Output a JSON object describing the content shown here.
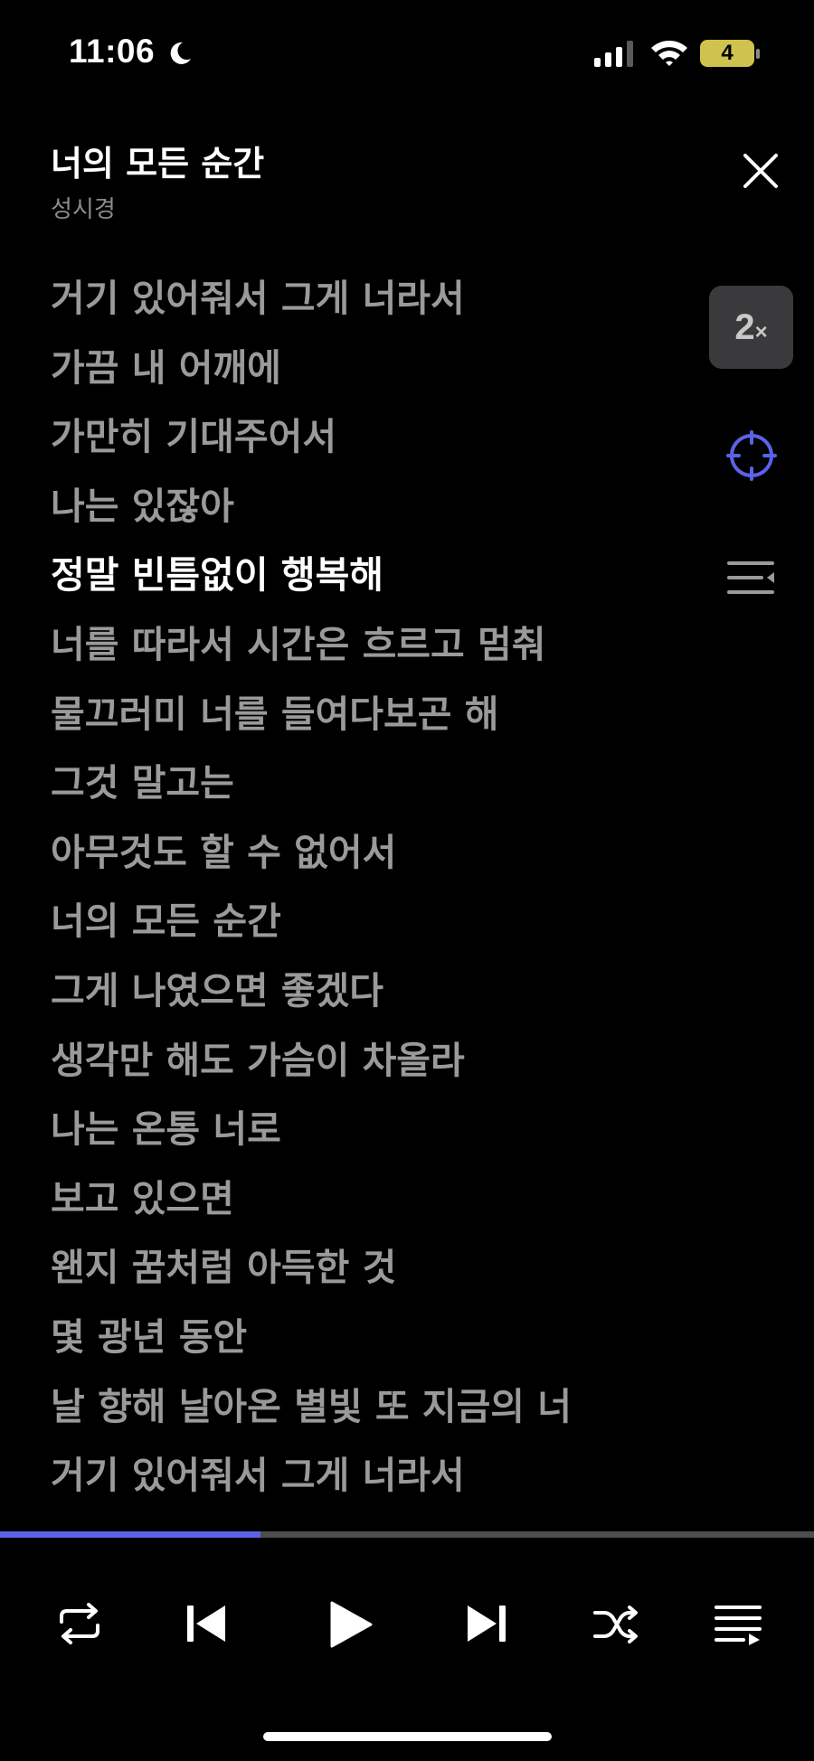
{
  "status_bar": {
    "time": "11:06",
    "battery": "4"
  },
  "header": {
    "title": "너의 모든 순간",
    "artist": "성시경"
  },
  "lyrics": [
    "거기 있어줘서 그게 너라서",
    "가끔 내 어깨에",
    "가만히 기대주어서",
    "나는 있잖아",
    "정말 빈틈없이 행복해",
    "너를 따라서 시간은 흐르고 멈춰",
    "물끄러미 너를 들여다보곤 해",
    "그것 말고는",
    "아무것도 할 수 없어서",
    "너의 모든 순간",
    "그게 나였으면 좋겠다",
    "생각만 해도 가슴이 차올라",
    "나는 온통 너로",
    "보고 있으면",
    "왠지 꿈처럼 아득한 것",
    "몇 광년 동안",
    "날 향해 날아온 별빛 또 지금의 너",
    "거기 있어줘서 그게 너라서"
  ],
  "current_lyric_index": 4,
  "side": {
    "speed_value": "2",
    "speed_unit": "×"
  },
  "playback": {
    "progress": 0.32
  },
  "colors": {
    "accent": "#5b62e8",
    "lyric_dim": "#9a9a9a",
    "lyric_current": "#ffffff"
  },
  "icons": [
    "moon-icon",
    "cellular-signal-icon",
    "wifi-icon",
    "battery-icon",
    "close-icon",
    "sync-target-icon",
    "lyrics-list-icon",
    "repeat-icon",
    "previous-track-icon",
    "play-icon",
    "next-track-icon",
    "shuffle-icon",
    "playlist-icon"
  ]
}
